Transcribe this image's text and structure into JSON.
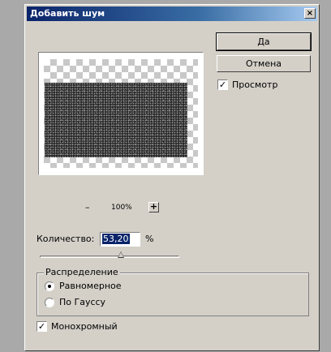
{
  "dialog": {
    "title": "Добавить шум",
    "close_label": "×"
  },
  "buttons": {
    "ok": "Да",
    "cancel": "Отмена"
  },
  "preview_toggle": {
    "label": "Просмотр",
    "checked": true,
    "mark": "✓"
  },
  "zoom": {
    "minus": "–",
    "level": "100%",
    "plus": "+"
  },
  "amount": {
    "label": "Количество:",
    "value": "53,20",
    "unit": "%"
  },
  "distribution": {
    "legend": "Распределение",
    "options": [
      {
        "label": "Равномерное",
        "selected": true
      },
      {
        "label": "По Гауссу",
        "selected": false
      }
    ]
  },
  "monochrome": {
    "label": "Монохромный",
    "checked": true,
    "mark": "✓"
  }
}
